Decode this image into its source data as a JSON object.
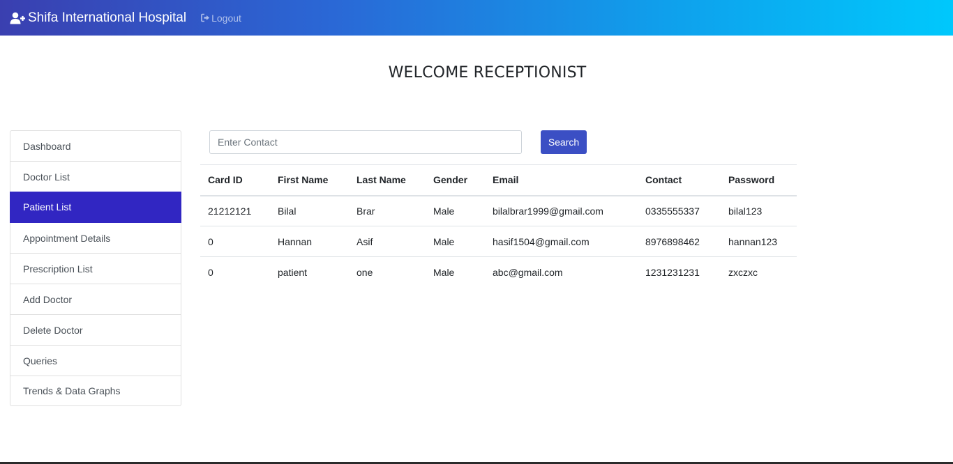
{
  "header": {
    "brand": "Shifa International Hospital",
    "brand_icon": "user-plus-icon",
    "logout_label": "Logout",
    "logout_icon": "sign-out-icon",
    "gradient_start": "#3a3fb0",
    "gradient_end": "#00c8fc"
  },
  "page": {
    "welcome": "WELCOME RECEPTIONIST"
  },
  "sidebar": {
    "active_color": "#3126c2",
    "items": [
      {
        "label": "Dashboard"
      },
      {
        "label": "Doctor List"
      },
      {
        "label": "Patient List",
        "active": true
      },
      {
        "label": "Appointment Details"
      },
      {
        "label": "Prescription List"
      },
      {
        "label": "Add Doctor"
      },
      {
        "label": "Delete Doctor"
      },
      {
        "label": "Queries"
      },
      {
        "label": "Trends & Data Graphs"
      }
    ]
  },
  "search": {
    "placeholder": "Enter Contact",
    "value": "",
    "button_label": "Search",
    "button_color": "#3b4fc4"
  },
  "table": {
    "columns": [
      "Card ID",
      "First Name",
      "Last Name",
      "Gender",
      "Email",
      "Contact",
      "Password"
    ],
    "rows": [
      [
        "21212121",
        "Bilal",
        "Brar",
        "Male",
        "bilalbrar1999@gmail.com",
        "0335555337",
        "bilal123"
      ],
      [
        "0",
        "Hannan",
        "Asif",
        "Male",
        "hasif1504@gmail.com",
        "8976898462",
        "hannan123"
      ],
      [
        "0",
        "patient",
        "one",
        "Male",
        "abc@gmail.com",
        "1231231231",
        "zxczxc"
      ]
    ]
  }
}
